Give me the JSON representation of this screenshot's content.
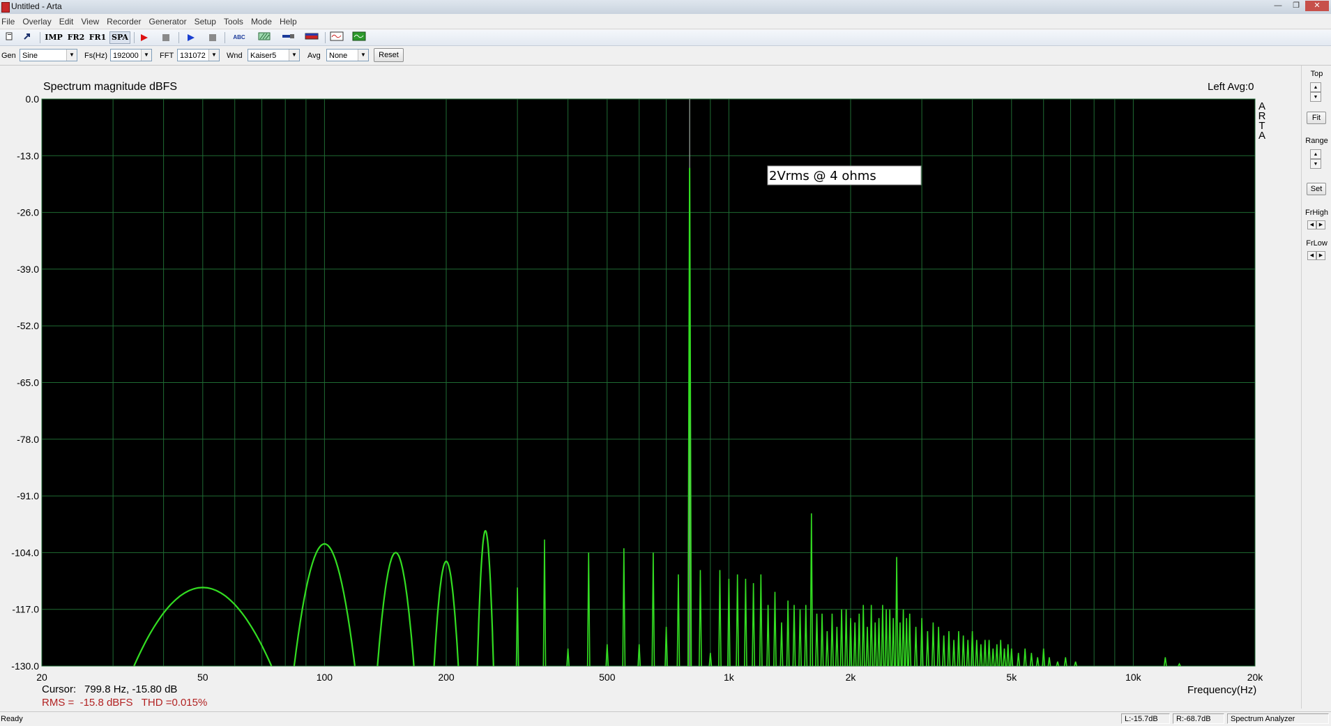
{
  "window": {
    "title": "Untitled - Arta",
    "controls": [
      "—",
      "❐",
      "✕"
    ]
  },
  "menu": [
    "File",
    "Overlay",
    "Edit",
    "View",
    "Recorder",
    "Generator",
    "Setup",
    "Tools",
    "Mode",
    "Help"
  ],
  "toolbar": {
    "imp_label": "IMP",
    "fr2_label": "FR2",
    "fr1_label": "FR1",
    "spa_label": "SPA",
    "abc_label": "ABC"
  },
  "settings": {
    "gen_label": "Gen",
    "gen_value": "Sine",
    "fs_label": "Fs(Hz)",
    "fs_value": "192000",
    "fft_label": "FFT",
    "fft_value": "131072",
    "wnd_label": "Wnd",
    "wnd_value": "Kaiser5",
    "avg_label": "Avg",
    "avg_value": "None",
    "reset_label": "Reset"
  },
  "chart_data": {
    "type": "line",
    "title": "Spectrum magnitude dBFS",
    "channel_info": "Left  Avg:0",
    "brand_vertical": "ARTA",
    "annotation": "2Vrms @ 4 ohms",
    "xlabel": "Frequency(Hz)",
    "x_scale": "log",
    "xlim": [
      20,
      20000
    ],
    "ylim": [
      -130,
      0
    ],
    "x_tick_values": [
      20,
      50,
      100,
      200,
      500,
      1000,
      2000,
      5000,
      10000,
      20000
    ],
    "x_tick_labels": [
      "20",
      "50",
      "100",
      "200",
      "500",
      "1k",
      "2k",
      "5k",
      "10k",
      "20k"
    ],
    "x_grid_values": [
      30,
      40,
      50,
      60,
      70,
      80,
      90,
      100,
      200,
      300,
      400,
      500,
      600,
      700,
      800,
      900,
      1000,
      2000,
      3000,
      4000,
      5000,
      6000,
      7000,
      8000,
      9000,
      10000
    ],
    "y_tick_labels": [
      "0.0",
      "-13.0",
      "-26.0",
      "-39.0",
      "-52.0",
      "-65.0",
      "-78.0",
      "-91.0",
      "-104.0",
      "-117.0",
      "-130.0"
    ],
    "y_tick_values": [
      0,
      -13,
      -26,
      -39,
      -52,
      -65,
      -78,
      -91,
      -104,
      -117,
      -130
    ],
    "grid": true,
    "trace_color": "#33dd22",
    "grid_color": "#1f6b33",
    "background": "#000000",
    "cursor_line_x": 799.8,
    "peaks": [
      [
        50,
        -112
      ],
      [
        100,
        -102
      ],
      [
        150,
        -104
      ],
      [
        200,
        -106
      ],
      [
        250,
        -99
      ],
      [
        300,
        -112
      ],
      [
        350,
        -101
      ],
      [
        400,
        -126
      ],
      [
        450,
        -104
      ],
      [
        500,
        -125
      ],
      [
        550,
        -103
      ],
      [
        600,
        -125
      ],
      [
        650,
        -104
      ],
      [
        700,
        -121
      ],
      [
        750,
        -109
      ],
      [
        799.8,
        -15.8
      ],
      [
        850,
        -108
      ],
      [
        900,
        -127
      ],
      [
        950,
        -108
      ],
      [
        1000,
        -110
      ],
      [
        1050,
        -109
      ],
      [
        1100,
        -110
      ],
      [
        1150,
        -111
      ],
      [
        1200,
        -109
      ],
      [
        1250,
        -116
      ],
      [
        1300,
        -113
      ],
      [
        1350,
        -120
      ],
      [
        1400,
        -115
      ],
      [
        1450,
        -116
      ],
      [
        1500,
        -117
      ],
      [
        1550,
        -116
      ],
      [
        1600,
        -95
      ],
      [
        1650,
        -118
      ],
      [
        1700,
        -118
      ],
      [
        1750,
        -122
      ],
      [
        1800,
        -118
      ],
      [
        1850,
        -121
      ],
      [
        1900,
        -117
      ],
      [
        1950,
        -117
      ],
      [
        2000,
        -119
      ],
      [
        2050,
        -120
      ],
      [
        2100,
        -118
      ],
      [
        2150,
        -116
      ],
      [
        2200,
        -121
      ],
      [
        2250,
        -116
      ],
      [
        2300,
        -120
      ],
      [
        2350,
        -119
      ],
      [
        2400,
        -116
      ],
      [
        2450,
        -117
      ],
      [
        2500,
        -117
      ],
      [
        2550,
        -119
      ],
      [
        2600,
        -105
      ],
      [
        2650,
        -120
      ],
      [
        2700,
        -117
      ],
      [
        2750,
        -119
      ],
      [
        2800,
        -118
      ],
      [
        2900,
        -121
      ],
      [
        3000,
        -119
      ],
      [
        3100,
        -122
      ],
      [
        3200,
        -120
      ],
      [
        3300,
        -121
      ],
      [
        3400,
        -123
      ],
      [
        3500,
        -122
      ],
      [
        3600,
        -124
      ],
      [
        3700,
        -122
      ],
      [
        3800,
        -123
      ],
      [
        3900,
        -124
      ],
      [
        4000,
        -122
      ],
      [
        4100,
        -124
      ],
      [
        4200,
        -125
      ],
      [
        4300,
        -124
      ],
      [
        4400,
        -124
      ],
      [
        4500,
        -126
      ],
      [
        4600,
        -125
      ],
      [
        4700,
        -124
      ],
      [
        4800,
        -126
      ],
      [
        4900,
        -125
      ],
      [
        5000,
        -126
      ],
      [
        5200,
        -127
      ],
      [
        5400,
        -126
      ],
      [
        5600,
        -127
      ],
      [
        5800,
        -128
      ],
      [
        6000,
        -126
      ],
      [
        6200,
        -128
      ],
      [
        6500,
        -129
      ],
      [
        6800,
        -128
      ],
      [
        7200,
        -129
      ],
      [
        12000,
        -128
      ],
      [
        13000,
        -129.5
      ]
    ],
    "skirt_peaks": [
      [
        50,
        -112,
        0.17
      ],
      [
        100,
        -102,
        0.075
      ],
      [
        150,
        -104,
        0.045
      ],
      [
        200,
        -106,
        0.03
      ],
      [
        250,
        -99,
        0.02
      ]
    ],
    "readout": {
      "cursor_label": "Cursor:",
      "cursor_value": "799.8 Hz, -15.80 dB",
      "rms_text": "RMS =  -15.8 dBFS   THD =0.015%"
    }
  },
  "right_panel": {
    "top_label": "Top",
    "fit_label": "Fit",
    "range_label": "Range",
    "set_label": "Set",
    "frhigh_label": "FrHigh",
    "frlow_label": "FrLow"
  },
  "status": {
    "ready": "Ready",
    "left_level": "L:-15.7dB",
    "right_level": "R:-68.7dB",
    "mode": "Spectrum Analyzer"
  }
}
